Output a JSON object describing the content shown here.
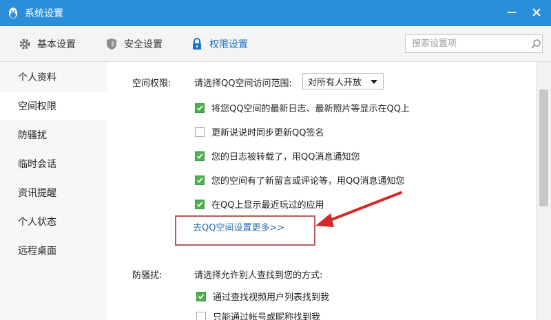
{
  "window": {
    "title": "系统设置"
  },
  "toolbar": {
    "tabs": [
      {
        "label": "基本设置",
        "icon": "gear-icon"
      },
      {
        "label": "安全设置",
        "icon": "shield-icon"
      },
      {
        "label": "权限设置",
        "icon": "lock-icon"
      }
    ],
    "active_tab": "权限设置",
    "search": {
      "placeholder": "搜索设置项",
      "value": ""
    }
  },
  "sidebar": {
    "items": [
      {
        "label": "个人资料"
      },
      {
        "label": "空间权限"
      },
      {
        "label": "防骚扰"
      },
      {
        "label": "临时会话"
      },
      {
        "label": "资讯提醒"
      },
      {
        "label": "个人状态"
      },
      {
        "label": "远程桌面"
      }
    ],
    "active": "空间权限"
  },
  "space": {
    "label": "空间权限:",
    "prompt": "请选择QQ空间访问范围:",
    "scope": "对所有人开放",
    "options": [
      {
        "label": "将您QQ空间的最新日志、最新照片等显示在QQ上",
        "checked": true
      },
      {
        "label": "更新说说时同步更新QQ签名",
        "checked": false
      },
      {
        "label": "您的日志被转载了，用QQ消息通知您",
        "checked": true
      },
      {
        "label": "您的空间有了新留言或评论等，用QQ消息通知您",
        "checked": true
      },
      {
        "label": "在QQ上显示最近玩过的应用",
        "checked": true
      }
    ],
    "more_link": "去QQ空间设置更多>>"
  },
  "antiharass": {
    "label": "防骚扰:",
    "prompt": "请选择允许别人查找到您的方式:",
    "options": [
      {
        "label": "通过查找视频用户列表找到我",
        "checked": true
      },
      {
        "label": "只能通过帐号或昵称找到我",
        "checked": false
      }
    ]
  },
  "colors": {
    "titlebar": "#2a8fd8",
    "accent": "#1a73c7",
    "check": "#4caf50",
    "link": "#2b6cb0",
    "annotation": "#d62828"
  }
}
